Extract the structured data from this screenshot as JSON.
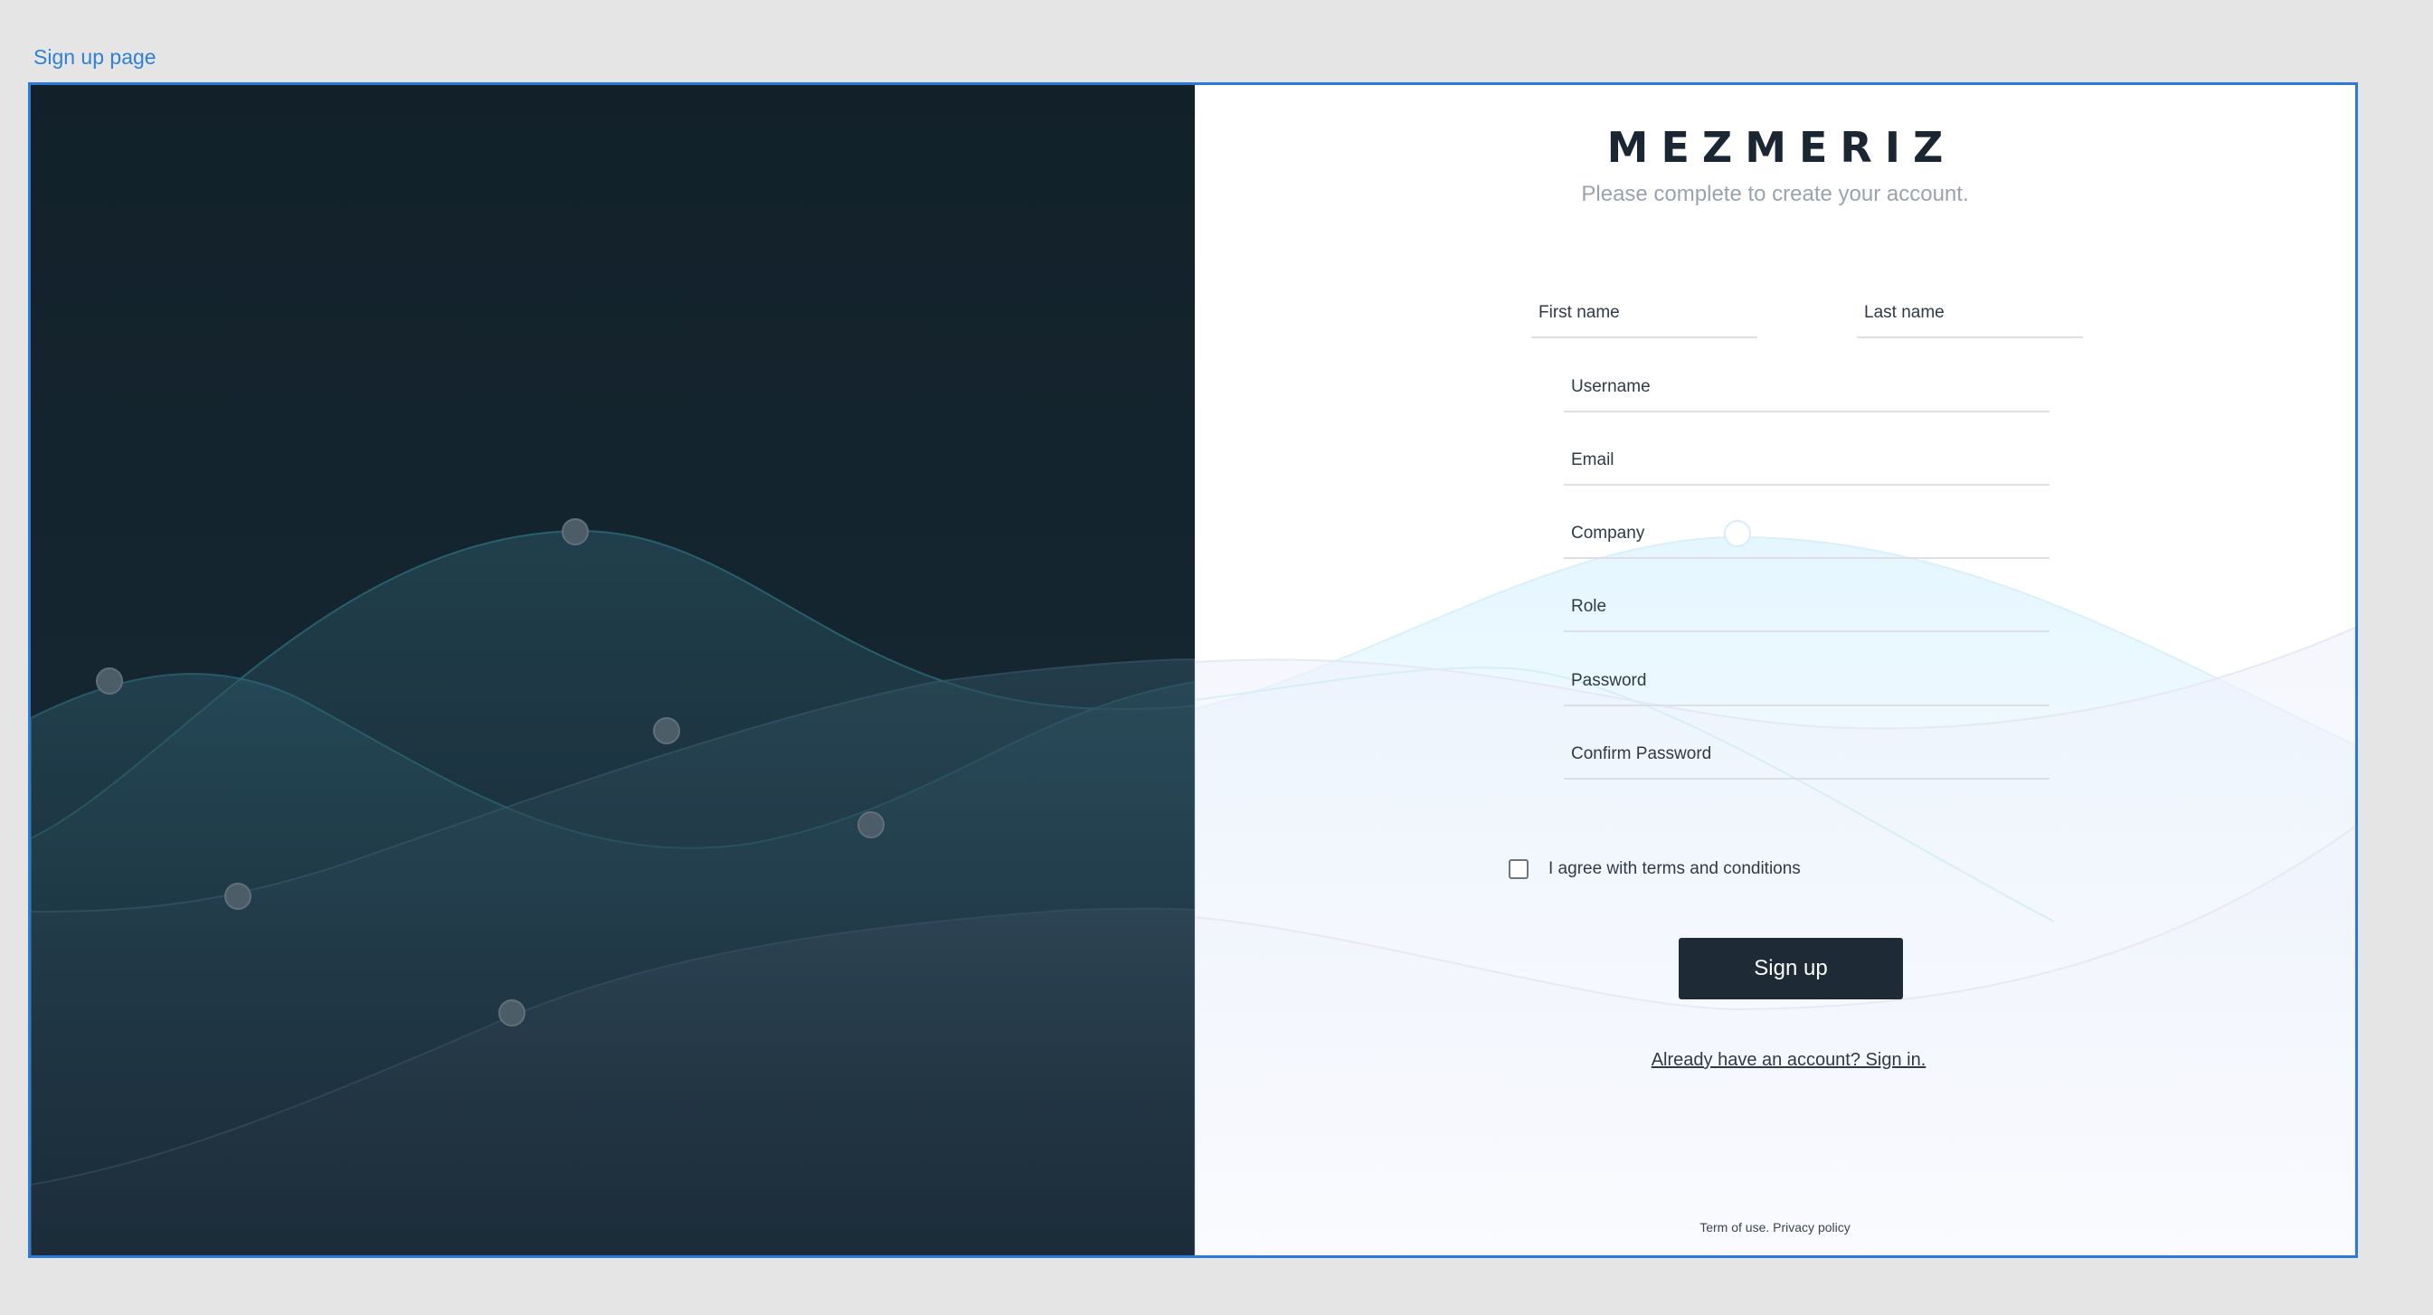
{
  "frame": {
    "label": "Sign up page"
  },
  "brand": {
    "name": "MEZMERIZ",
    "subtitle": "Please complete to create your account."
  },
  "form": {
    "first_name": {
      "placeholder": "First name",
      "value": ""
    },
    "last_name": {
      "placeholder": "Last name",
      "value": ""
    },
    "username": {
      "placeholder": "Username",
      "value": ""
    },
    "email": {
      "placeholder": "Email",
      "value": ""
    },
    "company": {
      "placeholder": "Company",
      "value": ""
    },
    "role": {
      "placeholder": "Role",
      "value": ""
    },
    "password": {
      "placeholder": "Password",
      "value": ""
    },
    "confirm_password": {
      "placeholder": "Confirm Password",
      "value": ""
    },
    "terms_label": "I agree with terms and conditions",
    "terms_checked": false,
    "submit_label": "Sign up",
    "signin_link": "Already have an account? Sign in."
  },
  "footer": {
    "terms": "Term of use.",
    "privacy": "Privacy policy"
  },
  "colors": {
    "frame_border": "#2b7ad8",
    "dark_panel": "#122129",
    "button": "#1e2a36",
    "brand_text": "#1a2733"
  }
}
